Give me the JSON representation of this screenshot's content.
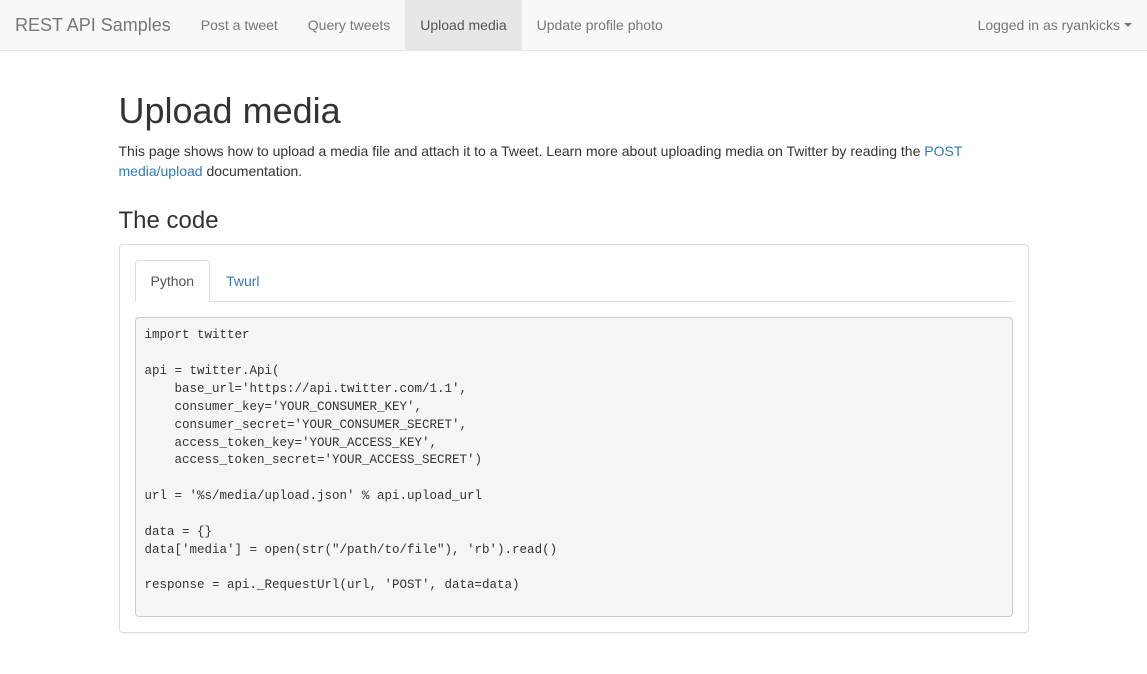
{
  "navbar": {
    "brand": "REST API Samples",
    "items": [
      {
        "label": "Post a tweet",
        "active": false
      },
      {
        "label": "Query tweets",
        "active": false
      },
      {
        "label": "Upload media",
        "active": true
      },
      {
        "label": "Update profile photo",
        "active": false
      }
    ],
    "account_label": "Logged in as ryankicks",
    "caret_icon": "chevron-down-icon"
  },
  "page": {
    "title": "Upload media",
    "intro_before_link": "This page shows how to upload a media file and attach it to a Tweet. Learn more about uploading media on Twitter by reading the ",
    "intro_link": "POST media/upload",
    "intro_after_link": " documentation.",
    "section_title": "The code"
  },
  "tabs": [
    {
      "label": "Python",
      "active": true
    },
    {
      "label": "Twurl",
      "active": false
    }
  ],
  "code": {
    "language": "python",
    "text": "import twitter\n\napi = twitter.Api(\n    base_url='https://api.twitter.com/1.1',\n    consumer_key='YOUR_CONSUMER_KEY',\n    consumer_secret='YOUR_CONSUMER_SECRET',\n    access_token_key='YOUR_ACCESS_KEY',\n    access_token_secret='YOUR_ACCESS_SECRET')\n\nurl = '%s/media/upload.json' % api.upload_url\n\ndata = {}\ndata['media'] = open(str(\"/path/to/file\"), 'rb').read()\n\nresponse = api._RequestUrl(url, 'POST', data=data)"
  },
  "colors": {
    "link": "#337ab7",
    "navbar_bg": "#f8f8f8",
    "navbar_active_bg": "#e7e7e7",
    "text": "#333333",
    "muted": "#777777",
    "code_bg": "#f5f5f5",
    "border": "#dddddd"
  }
}
